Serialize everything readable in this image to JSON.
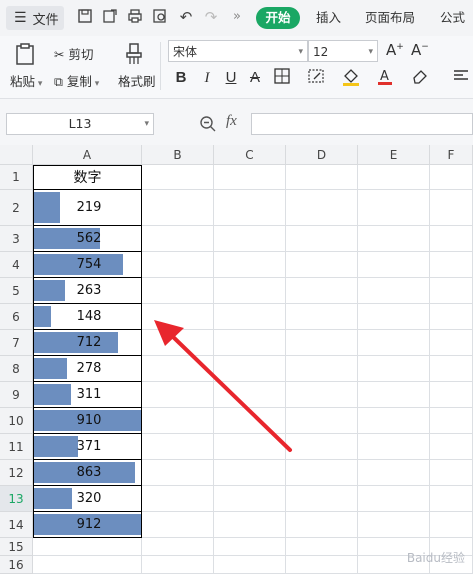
{
  "menu": {
    "file_label": "文件",
    "tabs": [
      "开始",
      "插入",
      "页面布局",
      "公式"
    ]
  },
  "ribbon": {
    "paste": "粘贴",
    "cut": "剪切",
    "copy": "复制",
    "format_painter": "格式刷",
    "font_name": "宋体",
    "font_size": "12",
    "bold": "B",
    "italic": "I",
    "underline": "U"
  },
  "formula_bar": {
    "name_box": "L13",
    "fx": "fx"
  },
  "columns": [
    "A",
    "B",
    "C",
    "D",
    "E",
    "F"
  ],
  "rows": [
    "1",
    "2",
    "3",
    "4",
    "5",
    "6",
    "7",
    "8",
    "9",
    "10",
    "11",
    "12",
    "13",
    "14",
    "15",
    "16"
  ],
  "active_row": "13",
  "sheet": {
    "header": "数字",
    "values": [
      219,
      562,
      754,
      263,
      148,
      712,
      278,
      311,
      910,
      371,
      863,
      320,
      912
    ],
    "bar_max": 912
  },
  "annotation": {
    "color": "#e8262d"
  },
  "watermark": "Baidu经验"
}
